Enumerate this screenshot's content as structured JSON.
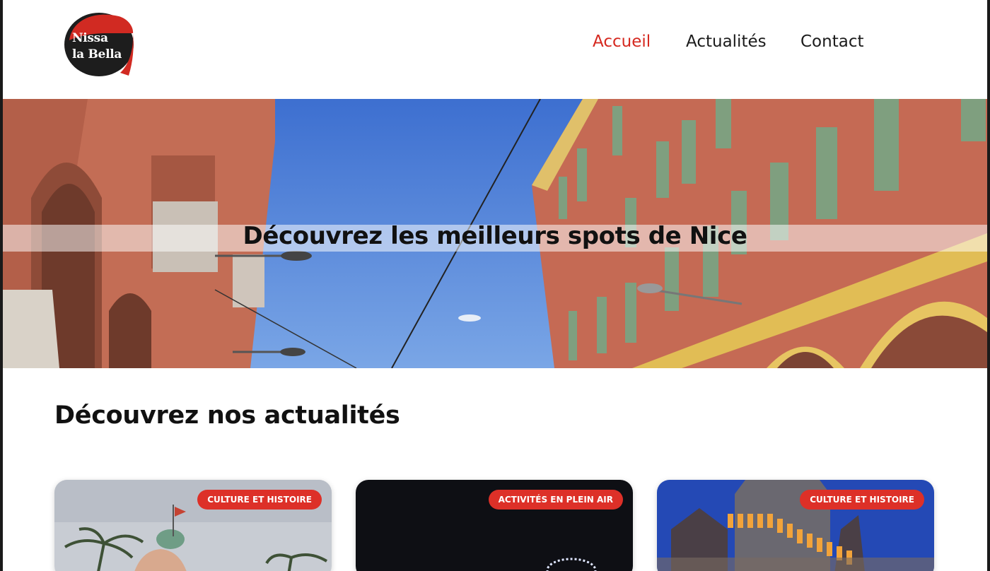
{
  "header": {
    "logo_line1": "Nissa",
    "logo_line2": "la Bella",
    "nav": [
      {
        "label": "Accueil",
        "active": true
      },
      {
        "label": "Actualités",
        "active": false
      },
      {
        "label": "Contact",
        "active": false
      }
    ]
  },
  "hero": {
    "title": "Découvrez les meilleurs spots de Nice"
  },
  "news": {
    "title": "Découvrez nos actualités",
    "cards": [
      {
        "category": "CULTURE ET HISTOIRE"
      },
      {
        "category": "ACTIVITÉS EN PLEIN AIR"
      },
      {
        "category": "CULTURE ET HISTOIRE"
      }
    ]
  },
  "colors": {
    "accent": "#d5281f",
    "badge": "#dd3028",
    "text": "#111111"
  }
}
